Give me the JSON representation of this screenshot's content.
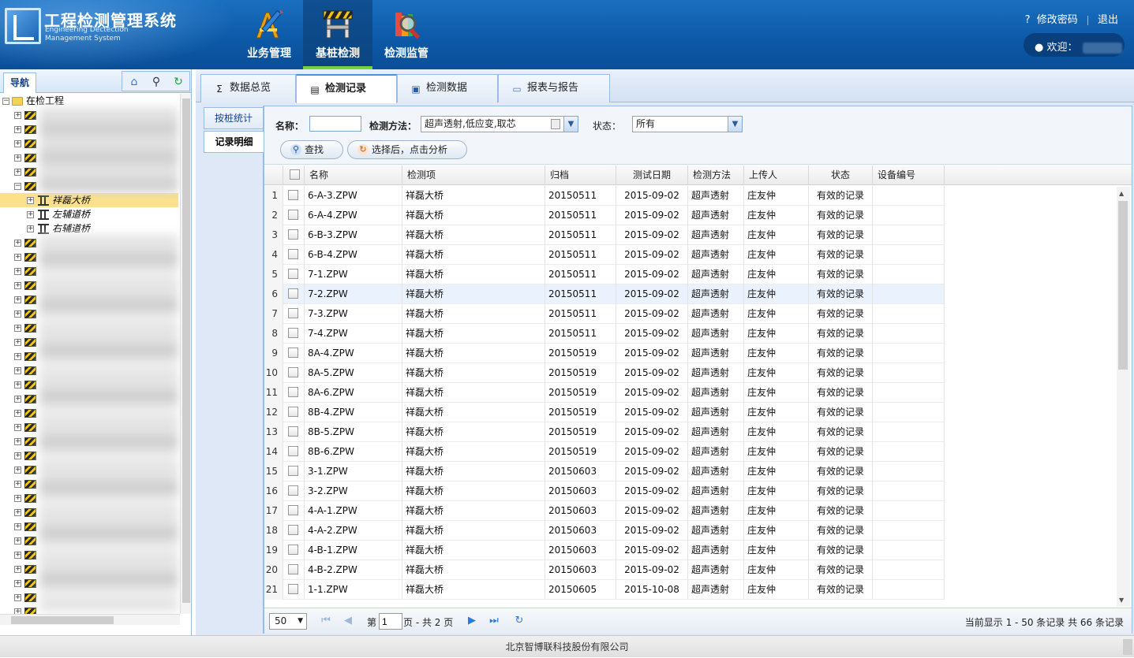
{
  "header": {
    "title": "工程检测管理系统",
    "subtitle_line1": "Engineering Dectection",
    "subtitle_line2": "Management System",
    "modules": [
      {
        "label": "业务管理",
        "icon": "ruler-pencil-icon"
      },
      {
        "label": "基桩检测",
        "icon": "construction-barrier-icon"
      },
      {
        "label": "检测监管",
        "icon": "magnifier-books-icon"
      }
    ],
    "active_module": "基桩检测",
    "change_password": "修改密码",
    "logout": "退出",
    "welcome": "欢迎："
  },
  "nav": {
    "tab": "导航",
    "tools": [
      "home-icon",
      "search-icon",
      "refresh-icon"
    ],
    "root": "在检工程",
    "children": [
      "祥磊大桥",
      "左辅道桥",
      "右辅道桥"
    ]
  },
  "tabs": [
    {
      "label": "数据总览",
      "icon": "sigma-icon"
    },
    {
      "label": "检测记录",
      "icon": "document-icon"
    },
    {
      "label": "检测数据",
      "icon": "floppy-icon"
    },
    {
      "label": "报表与报告",
      "icon": "report-icon"
    }
  ],
  "active_tab": "检测记录",
  "subtabs": [
    {
      "label": "按桩统计"
    },
    {
      "label": "记录明细"
    }
  ],
  "filter": {
    "name_label": "名称：",
    "name_value": "",
    "method_label": "检测方法：",
    "method_value": "超声透射,低应变,取芯",
    "state_label": "状态：",
    "state_value": "所有",
    "search_button": "查找",
    "analyze_button": "选择后，点击分析"
  },
  "grid": {
    "columns": [
      "名称",
      "检测项",
      "归档",
      "测试日期",
      "检测方法",
      "上传人",
      "状态",
      "设备编号"
    ],
    "rows": [
      {
        "no": "1",
        "name": "6-A-3.ZPW",
        "item": "祥磊大桥",
        "archive": "20150511",
        "date": "2015-09-02",
        "method": "超声透射",
        "uploader": "庄友仲",
        "state": "有效的记录",
        "device": ""
      },
      {
        "no": "2",
        "name": "6-A-4.ZPW",
        "item": "祥磊大桥",
        "archive": "20150511",
        "date": "2015-09-02",
        "method": "超声透射",
        "uploader": "庄友仲",
        "state": "有效的记录",
        "device": ""
      },
      {
        "no": "3",
        "name": "6-B-3.ZPW",
        "item": "祥磊大桥",
        "archive": "20150511",
        "date": "2015-09-02",
        "method": "超声透射",
        "uploader": "庄友仲",
        "state": "有效的记录",
        "device": ""
      },
      {
        "no": "4",
        "name": "6-B-4.ZPW",
        "item": "祥磊大桥",
        "archive": "20150511",
        "date": "2015-09-02",
        "method": "超声透射",
        "uploader": "庄友仲",
        "state": "有效的记录",
        "device": ""
      },
      {
        "no": "5",
        "name": "7-1.ZPW",
        "item": "祥磊大桥",
        "archive": "20150511",
        "date": "2015-09-02",
        "method": "超声透射",
        "uploader": "庄友仲",
        "state": "有效的记录",
        "device": ""
      },
      {
        "no": "6",
        "name": "7-2.ZPW",
        "item": "祥磊大桥",
        "archive": "20150511",
        "date": "2015-09-02",
        "method": "超声透射",
        "uploader": "庄友仲",
        "state": "有效的记录",
        "device": ""
      },
      {
        "no": "7",
        "name": "7-3.ZPW",
        "item": "祥磊大桥",
        "archive": "20150511",
        "date": "2015-09-02",
        "method": "超声透射",
        "uploader": "庄友仲",
        "state": "有效的记录",
        "device": ""
      },
      {
        "no": "8",
        "name": "7-4.ZPW",
        "item": "祥磊大桥",
        "archive": "20150511",
        "date": "2015-09-02",
        "method": "超声透射",
        "uploader": "庄友仲",
        "state": "有效的记录",
        "device": ""
      },
      {
        "no": "9",
        "name": "8A-4.ZPW",
        "item": "祥磊大桥",
        "archive": "20150519",
        "date": "2015-09-02",
        "method": "超声透射",
        "uploader": "庄友仲",
        "state": "有效的记录",
        "device": ""
      },
      {
        "no": "10",
        "name": "8A-5.ZPW",
        "item": "祥磊大桥",
        "archive": "20150519",
        "date": "2015-09-02",
        "method": "超声透射",
        "uploader": "庄友仲",
        "state": "有效的记录",
        "device": ""
      },
      {
        "no": "11",
        "name": "8A-6.ZPW",
        "item": "祥磊大桥",
        "archive": "20150519",
        "date": "2015-09-02",
        "method": "超声透射",
        "uploader": "庄友仲",
        "state": "有效的记录",
        "device": ""
      },
      {
        "no": "12",
        "name": "8B-4.ZPW",
        "item": "祥磊大桥",
        "archive": "20150519",
        "date": "2015-09-02",
        "method": "超声透射",
        "uploader": "庄友仲",
        "state": "有效的记录",
        "device": ""
      },
      {
        "no": "13",
        "name": "8B-5.ZPW",
        "item": "祥磊大桥",
        "archive": "20150519",
        "date": "2015-09-02",
        "method": "超声透射",
        "uploader": "庄友仲",
        "state": "有效的记录",
        "device": ""
      },
      {
        "no": "14",
        "name": "8B-6.ZPW",
        "item": "祥磊大桥",
        "archive": "20150519",
        "date": "2015-09-02",
        "method": "超声透射",
        "uploader": "庄友仲",
        "state": "有效的记录",
        "device": ""
      },
      {
        "no": "15",
        "name": "3-1.ZPW",
        "item": "祥磊大桥",
        "archive": "20150603",
        "date": "2015-09-02",
        "method": "超声透射",
        "uploader": "庄友仲",
        "state": "有效的记录",
        "device": ""
      },
      {
        "no": "16",
        "name": "3-2.ZPW",
        "item": "祥磊大桥",
        "archive": "20150603",
        "date": "2015-09-02",
        "method": "超声透射",
        "uploader": "庄友仲",
        "state": "有效的记录",
        "device": ""
      },
      {
        "no": "17",
        "name": "4-A-1.ZPW",
        "item": "祥磊大桥",
        "archive": "20150603",
        "date": "2015-09-02",
        "method": "超声透射",
        "uploader": "庄友仲",
        "state": "有效的记录",
        "device": ""
      },
      {
        "no": "18",
        "name": "4-A-2.ZPW",
        "item": "祥磊大桥",
        "archive": "20150603",
        "date": "2015-09-02",
        "method": "超声透射",
        "uploader": "庄友仲",
        "state": "有效的记录",
        "device": ""
      },
      {
        "no": "19",
        "name": "4-B-1.ZPW",
        "item": "祥磊大桥",
        "archive": "20150603",
        "date": "2015-09-02",
        "method": "超声透射",
        "uploader": "庄友仲",
        "state": "有效的记录",
        "device": ""
      },
      {
        "no": "20",
        "name": "4-B-2.ZPW",
        "item": "祥磊大桥",
        "archive": "20150603",
        "date": "2015-09-02",
        "method": "超声透射",
        "uploader": "庄友仲",
        "state": "有效的记录",
        "device": ""
      },
      {
        "no": "21",
        "name": "1-1.ZPW",
        "item": "祥磊大桥",
        "archive": "20150605",
        "date": "2015-10-08",
        "method": "超声透射",
        "uploader": "庄友仲",
        "state": "有效的记录",
        "device": ""
      }
    ],
    "highlighted_row": "6"
  },
  "pager": {
    "page_size": "50",
    "page_prefix": "第",
    "page_value": "1",
    "page_suffix": "页 - 共 2 页",
    "summary": "当前显示 1 - 50 条记录 共 66 条记录"
  },
  "footer": {
    "text": "北京智博联科技股份有限公司"
  },
  "colors": {
    "header_blue": "#0d5aa8",
    "active_green": "#74d33a",
    "border_blue": "#99bbe8"
  }
}
